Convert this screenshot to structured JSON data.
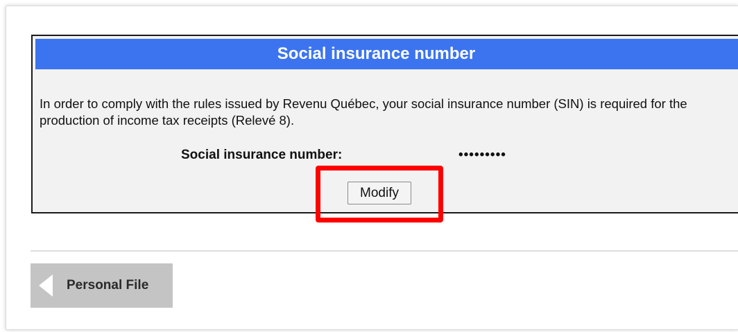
{
  "panel": {
    "title": "Social insurance number",
    "description": "In order to comply with the rules issued by Revenu Québec, your social insurance number (SIN) is required for the production of income tax receipts (Relevé 8).",
    "sin_label": "Social insurance number:",
    "sin_value_masked": "•••••••••",
    "modify_label": "Modify"
  },
  "navigation": {
    "back_label": "Personal File",
    "back_icon": "chevron-left-icon"
  },
  "colors": {
    "header_blue": "#3c74f0",
    "highlight_red": "#ff0000",
    "panel_bg": "#f2f2f2",
    "back_button_bg": "#c4c4c4"
  }
}
